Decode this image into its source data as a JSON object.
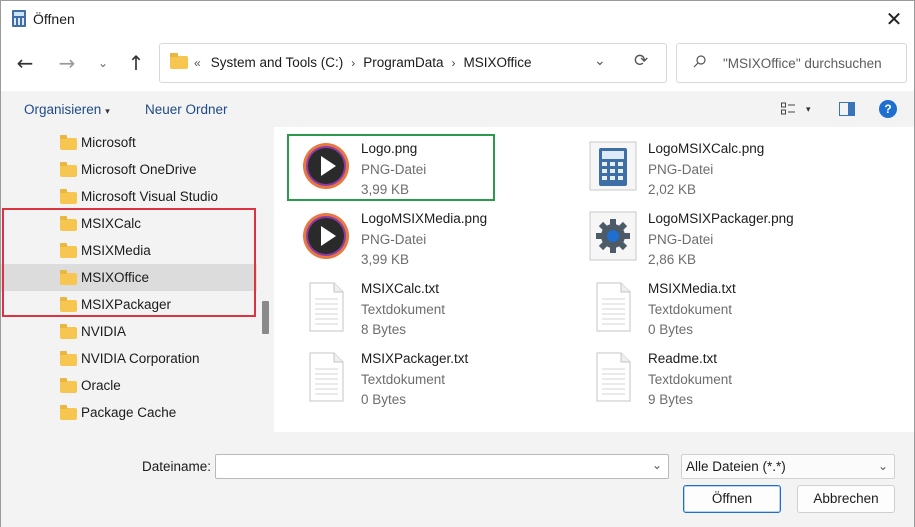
{
  "window": {
    "title": "Öffnen",
    "close_symbol": "✕",
    "icon": "calculator-app-icon"
  },
  "nav": {
    "back_symbol": "←",
    "forward_symbol": "→",
    "recent_symbol": "⌄",
    "up_symbol": "↑",
    "refresh_symbol": "⟳",
    "dropdown_symbol": "⌄"
  },
  "address": {
    "overflow": "«",
    "segments": [
      "System and Tools (C:)",
      "ProgramData",
      "MSIXOffice"
    ],
    "separator": "›"
  },
  "search": {
    "placeholder": "\"MSIXOffice\" durchsuchen"
  },
  "toolbar": {
    "organize_label": "Organisieren",
    "organize_caret": "▾",
    "new_folder_label": "Neuer Ordner",
    "view_caret": "▾",
    "help_label": "?"
  },
  "sidebar": {
    "items": [
      {
        "label": "Microsoft"
      },
      {
        "label": "Microsoft OneDrive"
      },
      {
        "label": "Microsoft Visual Studio"
      },
      {
        "label": "MSIXCalc"
      },
      {
        "label": "MSIXMedia"
      },
      {
        "label": "MSIXOffice",
        "selected": true
      },
      {
        "label": "MSIXPackager"
      },
      {
        "label": "NVIDIA"
      },
      {
        "label": "NVIDIA Corporation"
      },
      {
        "label": "Oracle"
      },
      {
        "label": "Package Cache"
      }
    ]
  },
  "files": [
    {
      "name": "Logo.png",
      "type": "PNG-Datei",
      "size": "3,99 KB",
      "icon": "play-logo-icon"
    },
    {
      "name": "LogoMSIXCalc.png",
      "type": "PNG-Datei",
      "size": "2,02 KB",
      "icon": "calculator-icon"
    },
    {
      "name": "LogoMSIXMedia.png",
      "type": "PNG-Datei",
      "size": "3,99 KB",
      "icon": "play-logo-icon"
    },
    {
      "name": "LogoMSIXPackager.png",
      "type": "PNG-Datei",
      "size": "2,86 KB",
      "icon": "gear-icon"
    },
    {
      "name": "MSIXCalc.txt",
      "type": "Textdokument",
      "size": "8 Bytes",
      "icon": "text-document-icon"
    },
    {
      "name": "MSIXMedia.txt",
      "type": "Textdokument",
      "size": "0 Bytes",
      "icon": "text-document-icon"
    },
    {
      "name": "MSIXPackager.txt",
      "type": "Textdokument",
      "size": "0 Bytes",
      "icon": "text-document-icon"
    },
    {
      "name": "Readme.txt",
      "type": "Textdokument",
      "size": "9 Bytes",
      "icon": "text-document-icon"
    }
  ],
  "bottom": {
    "filename_label": "Dateiname:",
    "filename_value": "",
    "filename_caret": "⌄",
    "filter_value": "Alle Dateien (*.*)",
    "filter_caret": "⌄",
    "open_label": "Öffnen",
    "cancel_label": "Abbrechen"
  },
  "colors": {
    "accent": "#1f6fd0",
    "folder": "#f6c650",
    "highlight_red": "#d9343f",
    "highlight_green": "#2c9a4a"
  }
}
